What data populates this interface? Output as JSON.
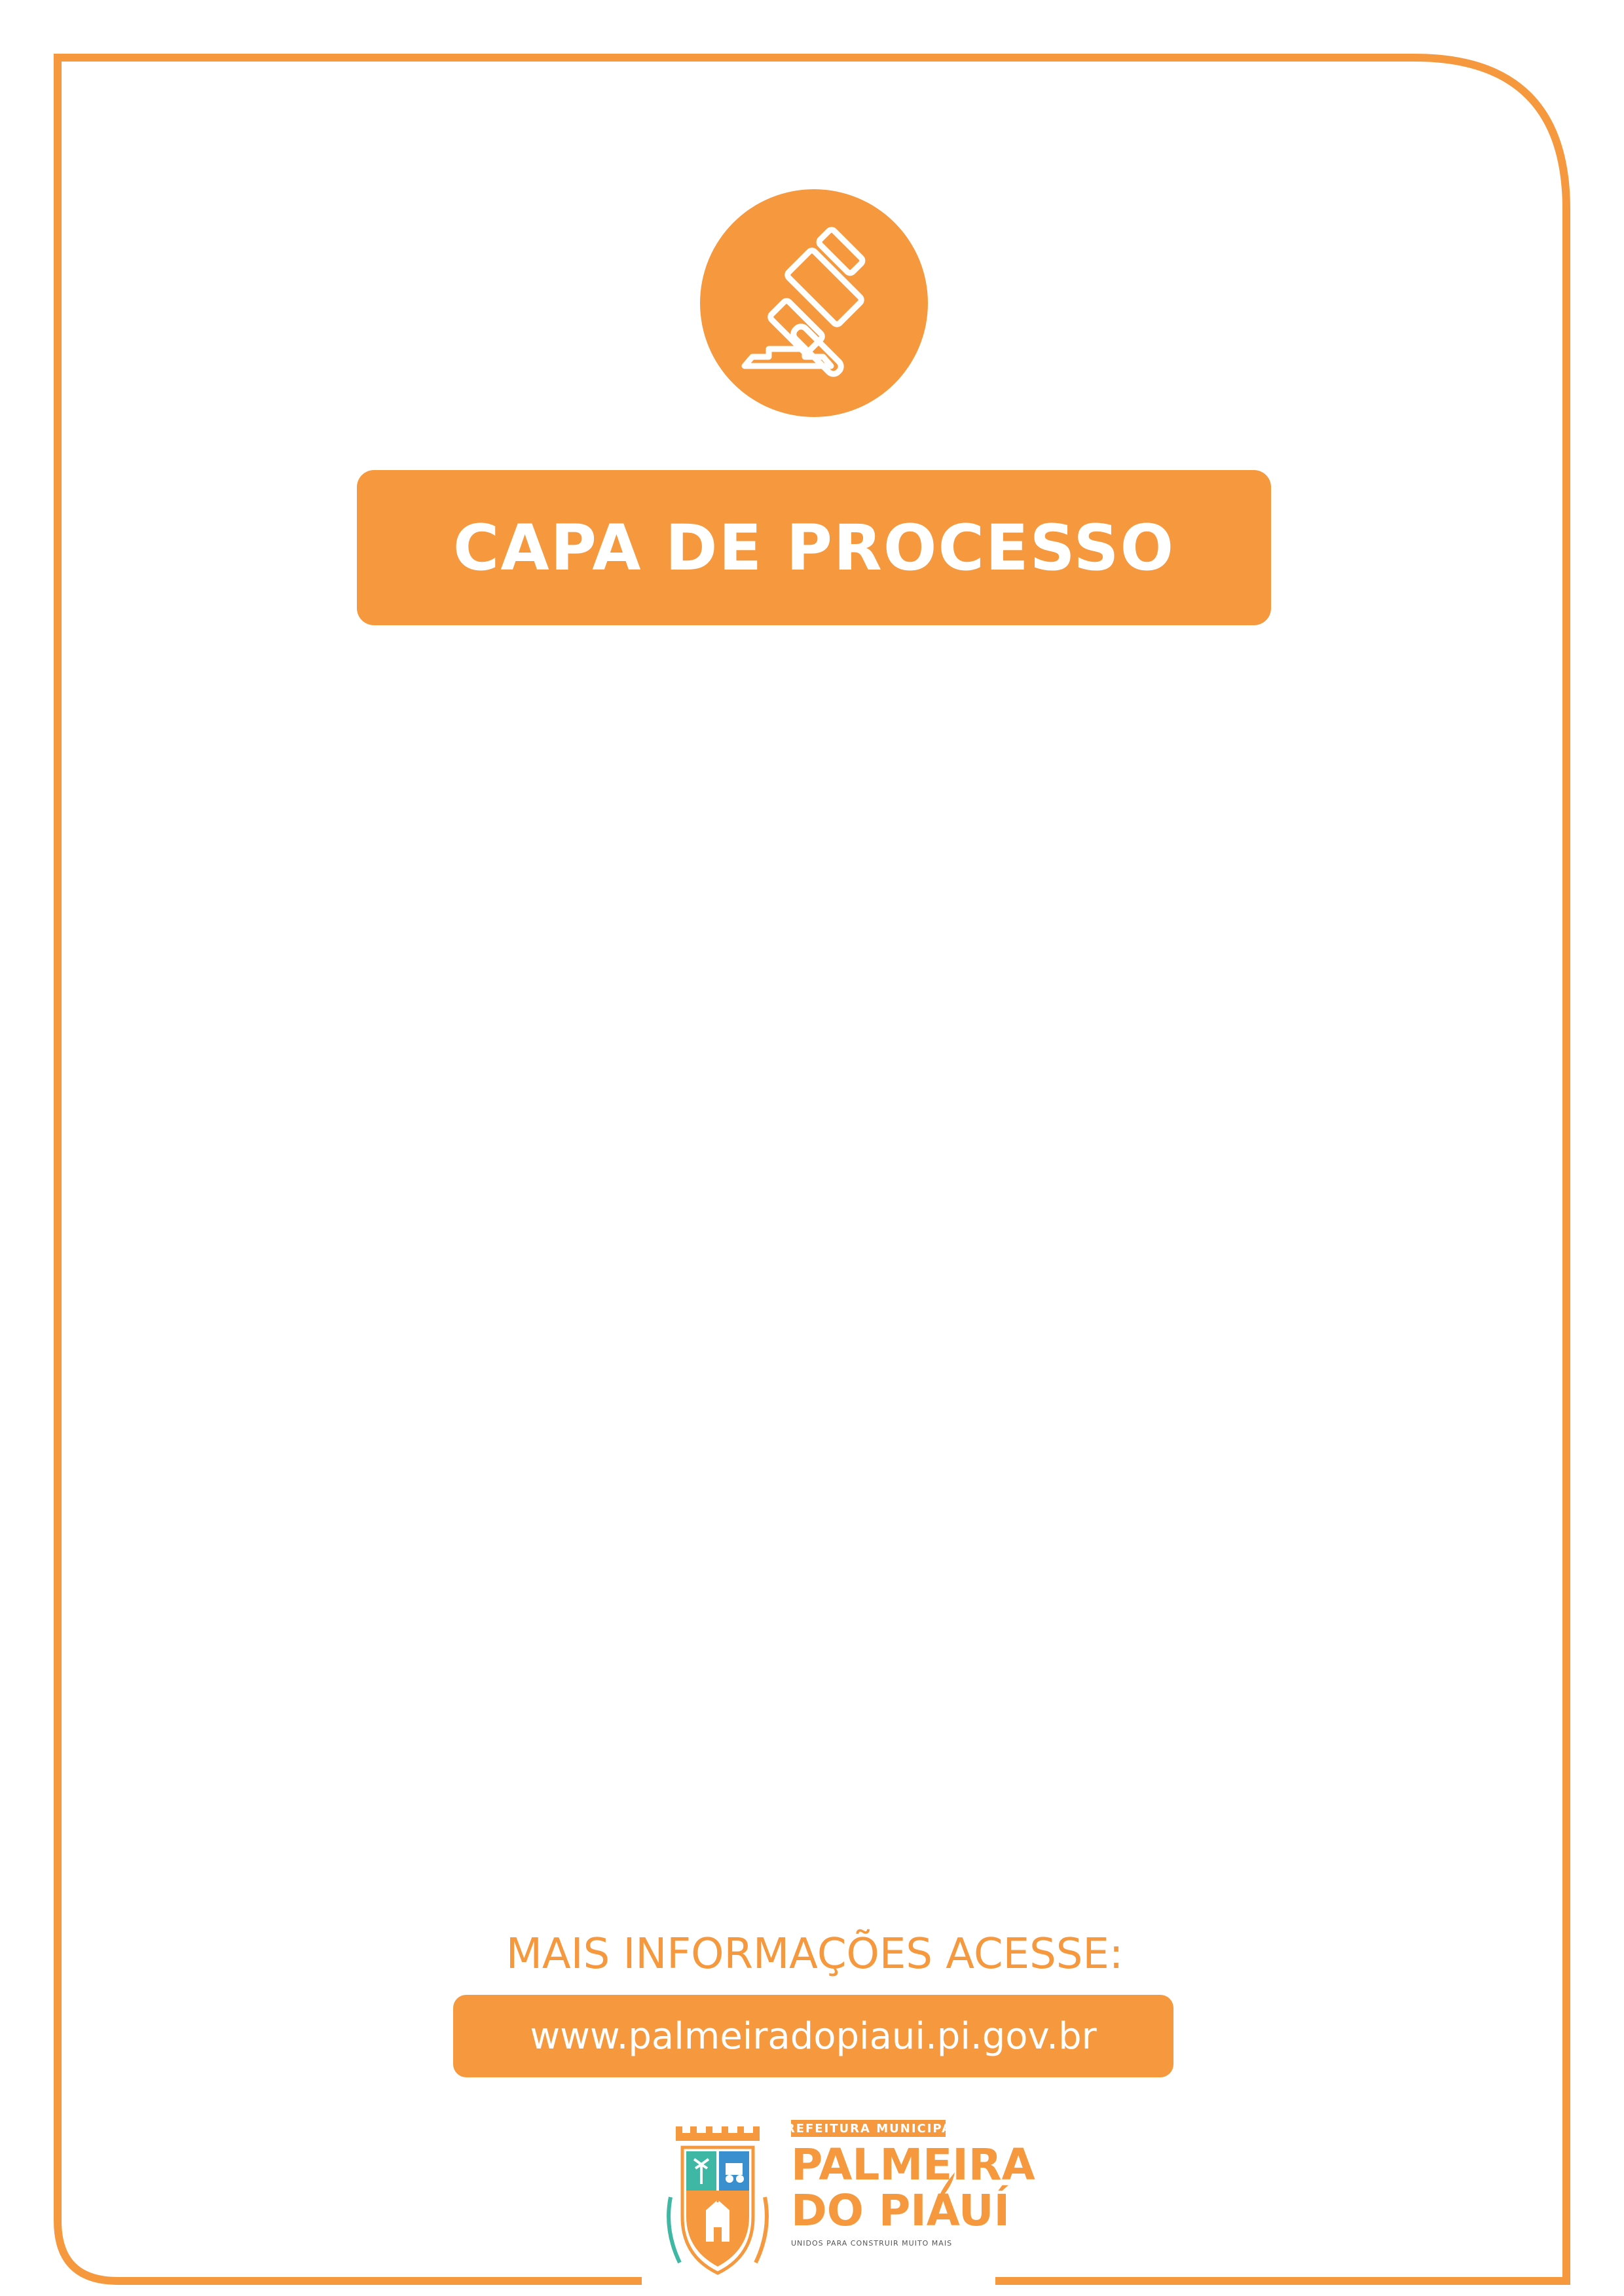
{
  "header": {
    "badge_icon": "gavel-icon",
    "title": "CAPA DE PROCESSO"
  },
  "footer": {
    "info_label": "MAIS INFORMAÇÕES ACESSE:",
    "url": "www.palmeiradopiaui.pi.gov.br",
    "logo": {
      "crest_icon": "municipal-crest-icon",
      "top_band": "PREFEITURA MUNICIPAL",
      "line1": "PALMEIRA",
      "line2": "DO PIAUÍ",
      "tagline": "UNIDOS PARA CONSTRUIR MUITO MAIS"
    }
  },
  "colors": {
    "accent": "#f5983e",
    "background": "#ffffff",
    "text_on_accent": "#ffffff"
  }
}
